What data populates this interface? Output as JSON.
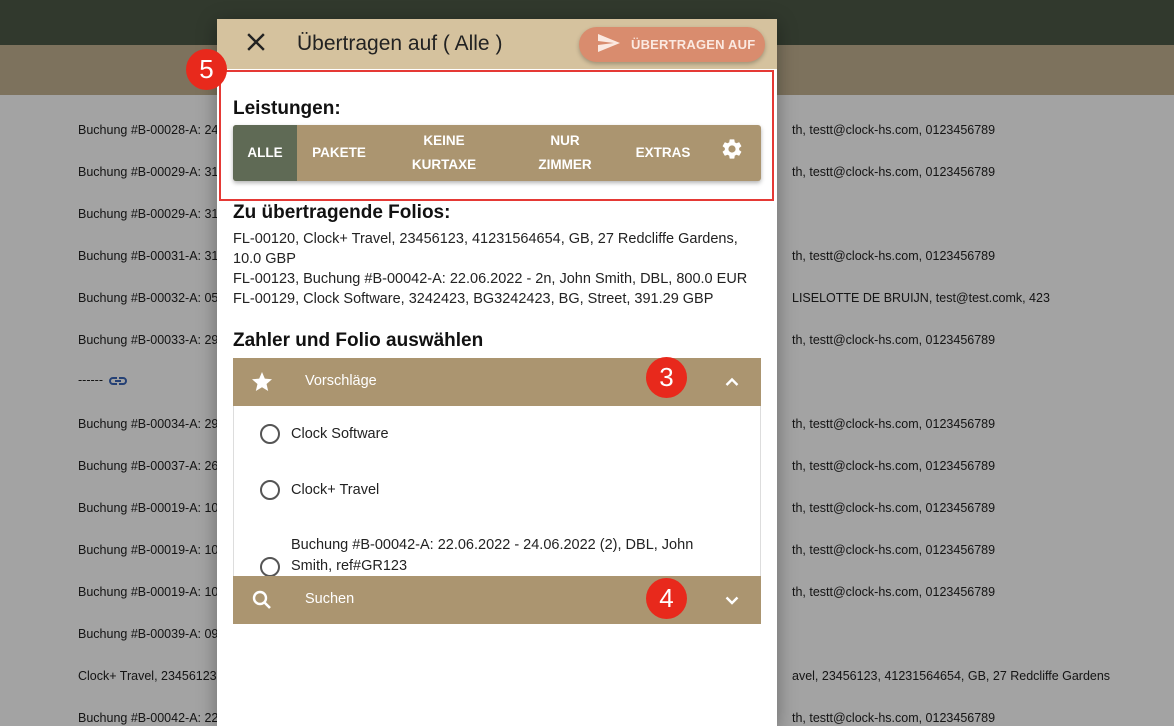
{
  "background": {
    "rows": [
      {
        "left": "Buchung #B-00028-A: 24",
        "right": "th, testt@clock-hs.com, 0123456789"
      },
      {
        "left": "Buchung #B-00029-A: 31",
        "right": "th, testt@clock-hs.com, 0123456789"
      },
      {
        "left": "Buchung #B-00029-A: 31",
        "right": ""
      },
      {
        "left": "Buchung #B-00031-A: 31",
        "right": "th, testt@clock-hs.com, 0123456789"
      },
      {
        "left": "Buchung #B-00032-A: 05",
        "right": "LISELOTTE DE BRUIJN, test@test.comk, 423"
      },
      {
        "left": "Buchung #B-00033-A: 29",
        "right": "th, testt@clock-hs.com, 0123456789"
      },
      {
        "left": "------",
        "right": "",
        "link": true
      },
      {
        "left": "Buchung #B-00034-A: 29",
        "right": "th, testt@clock-hs.com, 0123456789"
      },
      {
        "left": "Buchung #B-00037-A: 26",
        "right": "th, testt@clock-hs.com, 0123456789"
      },
      {
        "left": "Buchung #B-00019-A: 10",
        "right": "th, testt@clock-hs.com, 0123456789"
      },
      {
        "left": "Buchung #B-00019-A: 10",
        "right": "th, testt@clock-hs.com, 0123456789"
      },
      {
        "left": "Buchung #B-00019-A: 10",
        "right": "th, testt@clock-hs.com, 0123456789"
      },
      {
        "left": "Buchung #B-00039-A: 09",
        "right": ""
      },
      {
        "left": "Clock+ Travel, 23456123,",
        "right": "avel, 23456123, 41231564654, GB, 27 Redcliffe Gardens"
      },
      {
        "left": "Buchung #B-00042-A: 22",
        "right": "th, testt@clock-hs.com, 0123456789"
      }
    ]
  },
  "dialog": {
    "title": "Übertragen auf ( Alle )",
    "transfer_button": "ÜBERTRAGEN AUF",
    "services_title": "Leistungen:",
    "tabs": [
      {
        "line1": "ALLE",
        "line2": "",
        "active": true
      },
      {
        "line1": "PAKETE",
        "line2": "",
        "active": false
      },
      {
        "line1": "KEINE",
        "line2": "KURTAXE",
        "active": false
      },
      {
        "line1": "NUR",
        "line2": "ZIMMER",
        "active": false
      },
      {
        "line1": "EXTRAS",
        "line2": "",
        "active": false
      }
    ],
    "folios_title": "Zu übertragende Folios:",
    "folios": [
      "FL-00120, Clock+ Travel, 23456123, 41231564654, GB, 27 Redcliffe Gardens, 10.0 GBP",
      "FL-00123, Buchung #B-00042-A: 22.06.2022 - 2n, John Smith, DBL, 800.0 EUR",
      "FL-00129, Clock Software, 3242423, BG3242423, BG, Street, 391.29 GBP"
    ],
    "payer_title": "Zahler und Folio auswählen",
    "suggestions_label": "Vorschläge",
    "options": [
      "Clock Software",
      "Clock+ Travel",
      "Buchung #B-00042-A: 22.06.2022 - 24.06.2022 (2), DBL, John Smith, ref#GR123"
    ],
    "search_label": "Suchen"
  },
  "annotations": {
    "badge_services": "5",
    "badge_suggestions": "3",
    "badge_search": "4"
  },
  "colors": {
    "header": "#d5c29e",
    "accent": "#ab9570",
    "active_tab": "#5f6a55",
    "transfer_button": "#d98c6e",
    "badge": "#e8291c",
    "highlight": "#e53935"
  }
}
